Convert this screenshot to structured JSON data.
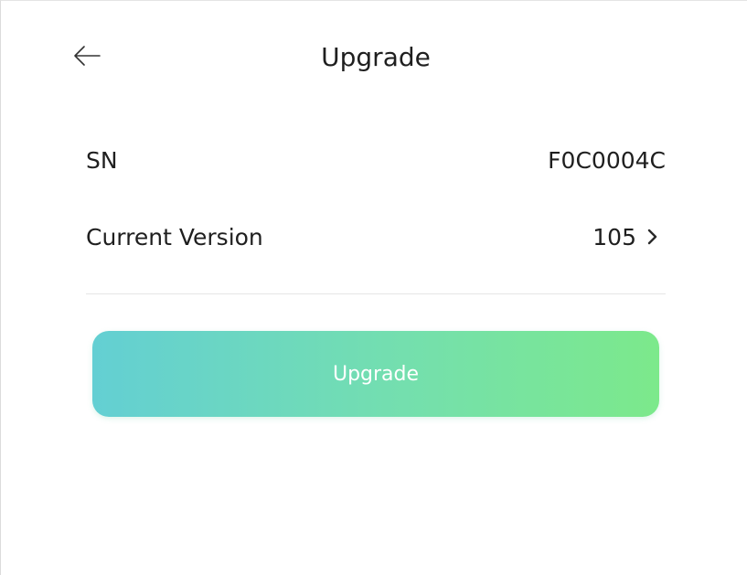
{
  "header": {
    "title": "Upgrade",
    "back_icon": "arrow-left-icon"
  },
  "device_info": {
    "sn_label": "SN",
    "sn_value": "F0C0004C",
    "version_label": "Current Version",
    "version_value": "105",
    "version_chevron_icon": "chevron-right-icon"
  },
  "actions": {
    "upgrade_label": "Upgrade"
  },
  "colors": {
    "button_gradient_start": "#63cfd3",
    "button_gradient_end": "#7ce98b",
    "text_primary": "#1f1f1f",
    "divider": "#e6e6e6"
  }
}
